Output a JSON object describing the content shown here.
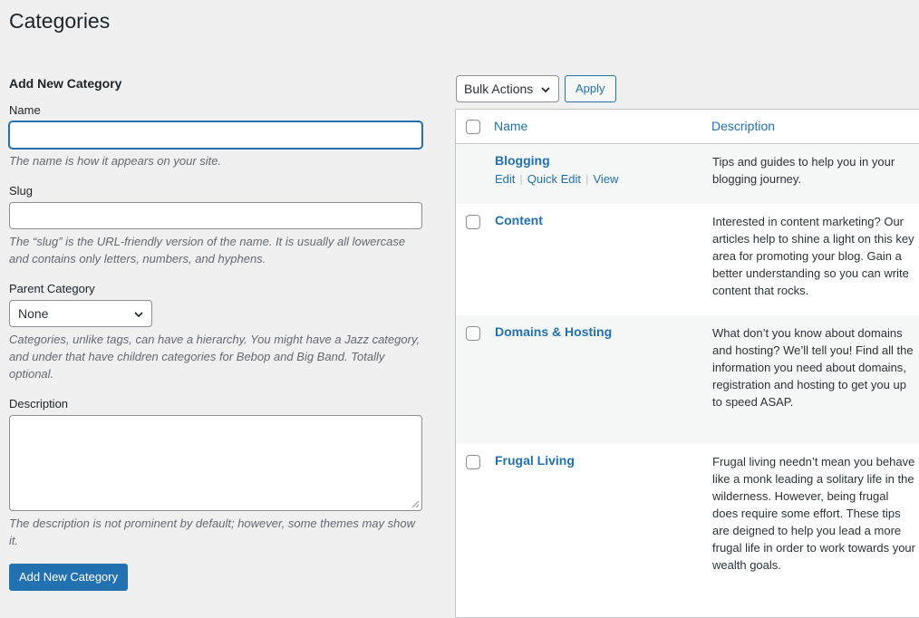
{
  "page": {
    "title": "Categories"
  },
  "form": {
    "heading": "Add New Category",
    "name": {
      "label": "Name",
      "value": "",
      "help": "The name is how it appears on your site."
    },
    "slug": {
      "label": "Slug",
      "value": "",
      "help": "The “slug” is the URL-friendly version of the name. It is usually all lowercase and contains only letters, numbers, and hyphens."
    },
    "parent": {
      "label": "Parent Category",
      "selected": "None",
      "help": "Categories, unlike tags, can have a hierarchy. You might have a Jazz category, and under that have children categories for Bebop and Big Band. Totally optional."
    },
    "description": {
      "label": "Description",
      "value": "",
      "help": "The description is not prominent by default; however, some themes may show it."
    },
    "submit_label": "Add New Category"
  },
  "toolbar": {
    "bulk_actions": "Bulk Actions",
    "apply_label": "Apply"
  },
  "table": {
    "columns": {
      "name": "Name",
      "description": "Description"
    },
    "rows": [
      {
        "name": "Blogging",
        "description": "Tips and guides to help you in your blogging journey.",
        "actions": [
          "Edit",
          "Quick Edit",
          "View"
        ]
      },
      {
        "name": "Content",
        "description": "Interested in content marketing? Our articles help to shine a light on this key area for promoting your blog. Gain a better understanding so you can write content that rocks."
      },
      {
        "name": "Domains & Hosting",
        "description": "What don’t you know about domains and hosting? We’ll tell you! Find all the information you need about domains, registration and hosting to get you up to speed ASAP."
      },
      {
        "name": "Frugal Living",
        "description": "Frugal living needn’t mean you behave like a monk leading a solitary life in the wilderness. However, being frugal does require some effort. These tips are deigned to help you lead a more frugal life in order to work towards your wealth goals."
      }
    ]
  },
  "colors": {
    "accent": "#2271b1",
    "background": "#f0f0f1",
    "text": "#1d2327",
    "muted": "#646970"
  }
}
